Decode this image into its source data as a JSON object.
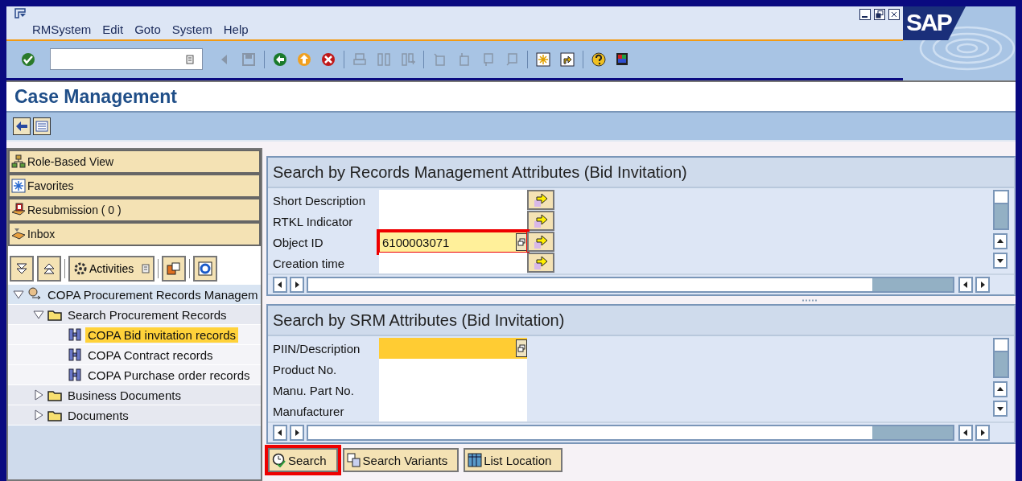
{
  "window": {
    "menu": [
      "RMSystem",
      "Edit",
      "Goto",
      "System",
      "Help"
    ],
    "logo": "SAP"
  },
  "screen_title": "Case Management",
  "navigator": {
    "views": [
      {
        "label": "Role-Based View",
        "kind": "role"
      },
      {
        "label": "Favorites",
        "kind": "favorites"
      },
      {
        "label": "Resubmission ( 0 )",
        "kind": "resubmission"
      },
      {
        "label": "Inbox",
        "kind": "inbox"
      }
    ],
    "activities": "Activities",
    "tree": [
      {
        "label": "COPA Procurement Records Managem",
        "kind": "role",
        "expanded": true,
        "selected": false,
        "children": [
          {
            "label": "Search Procurement Records",
            "kind": "folder",
            "expanded": true,
            "selected": false,
            "children": [
              {
                "label": "COPA Bid invitation records",
                "kind": "search",
                "selected": true
              },
              {
                "label": "COPA Contract records",
                "kind": "search",
                "selected": false
              },
              {
                "label": "COPA Purchase order records",
                "kind": "search",
                "selected": false
              }
            ]
          },
          {
            "label": "Business Documents",
            "kind": "folder",
            "expanded": false,
            "selected": false
          },
          {
            "label": "Documents",
            "kind": "folder",
            "expanded": false,
            "selected": false
          }
        ]
      }
    ]
  },
  "sections": [
    {
      "title": "Search by Records Management Attributes (Bid Invitation)",
      "fields": [
        {
          "label": "Short Description",
          "multiple_selection": true,
          "value_help": false,
          "focused": false,
          "annotated": false
        },
        {
          "label": "RTKL Indicator",
          "multiple_selection": true,
          "value_help": false,
          "focused": false,
          "annotated": false
        },
        {
          "label": "Object ID",
          "value": "6100003071",
          "multiple_selection": true,
          "value_help": true,
          "focused": false,
          "annotated": true
        },
        {
          "label": "Creation time",
          "multiple_selection": true,
          "value_help": false,
          "focused": false,
          "annotated": false
        }
      ]
    },
    {
      "title": "Search by SRM Attributes (Bid Invitation)",
      "fields": [
        {
          "label": "PIIN/Description",
          "multiple_selection": false,
          "value_help": true,
          "focused": true,
          "annotated": false
        },
        {
          "label": "Product No.",
          "multiple_selection": false,
          "value_help": false,
          "focused": false,
          "annotated": false
        },
        {
          "label": "Manu. Part No.",
          "multiple_selection": false,
          "value_help": false,
          "focused": false,
          "annotated": false
        },
        {
          "label": "Manufacturer",
          "multiple_selection": false,
          "value_help": false,
          "focused": false,
          "annotated": false
        }
      ]
    }
  ],
  "buttons": [
    {
      "label": "Search",
      "kind": "search",
      "annotated": true
    },
    {
      "label": "Search Variants",
      "kind": "variants",
      "annotated": false
    },
    {
      "label": "List Location",
      "kind": "list",
      "annotated": false
    }
  ]
}
